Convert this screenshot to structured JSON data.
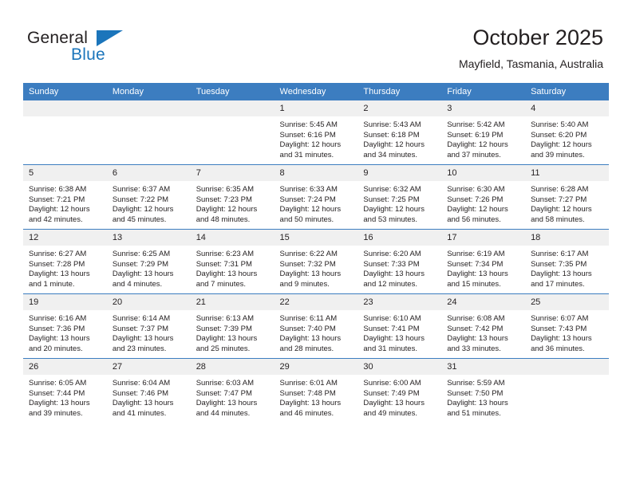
{
  "brand": {
    "name_top": "General",
    "name_bottom": "Blue",
    "triangle_icon": "triangle-icon",
    "accent_color": "#1b75bb"
  },
  "header": {
    "title": "October 2025",
    "subtitle": "Mayfield, Tasmania, Australia"
  },
  "calendar": {
    "header_bg": "#3c7dc0",
    "daynum_bg": "#f0f0f0",
    "weekdays": [
      "Sunday",
      "Monday",
      "Tuesday",
      "Wednesday",
      "Thursday",
      "Friday",
      "Saturday"
    ],
    "weeks": [
      [
        {
          "day": "",
          "empty": true
        },
        {
          "day": "",
          "empty": true
        },
        {
          "day": "",
          "empty": true
        },
        {
          "day": "1",
          "sunrise": "Sunrise: 5:45 AM",
          "sunset": "Sunset: 6:16 PM",
          "daylight1": "Daylight: 12 hours",
          "daylight2": "and 31 minutes."
        },
        {
          "day": "2",
          "sunrise": "Sunrise: 5:43 AM",
          "sunset": "Sunset: 6:18 PM",
          "daylight1": "Daylight: 12 hours",
          "daylight2": "and 34 minutes."
        },
        {
          "day": "3",
          "sunrise": "Sunrise: 5:42 AM",
          "sunset": "Sunset: 6:19 PM",
          "daylight1": "Daylight: 12 hours",
          "daylight2": "and 37 minutes."
        },
        {
          "day": "4",
          "sunrise": "Sunrise: 5:40 AM",
          "sunset": "Sunset: 6:20 PM",
          "daylight1": "Daylight: 12 hours",
          "daylight2": "and 39 minutes."
        }
      ],
      [
        {
          "day": "5",
          "sunrise": "Sunrise: 6:38 AM",
          "sunset": "Sunset: 7:21 PM",
          "daylight1": "Daylight: 12 hours",
          "daylight2": "and 42 minutes."
        },
        {
          "day": "6",
          "sunrise": "Sunrise: 6:37 AM",
          "sunset": "Sunset: 7:22 PM",
          "daylight1": "Daylight: 12 hours",
          "daylight2": "and 45 minutes."
        },
        {
          "day": "7",
          "sunrise": "Sunrise: 6:35 AM",
          "sunset": "Sunset: 7:23 PM",
          "daylight1": "Daylight: 12 hours",
          "daylight2": "and 48 minutes."
        },
        {
          "day": "8",
          "sunrise": "Sunrise: 6:33 AM",
          "sunset": "Sunset: 7:24 PM",
          "daylight1": "Daylight: 12 hours",
          "daylight2": "and 50 minutes."
        },
        {
          "day": "9",
          "sunrise": "Sunrise: 6:32 AM",
          "sunset": "Sunset: 7:25 PM",
          "daylight1": "Daylight: 12 hours",
          "daylight2": "and 53 minutes."
        },
        {
          "day": "10",
          "sunrise": "Sunrise: 6:30 AM",
          "sunset": "Sunset: 7:26 PM",
          "daylight1": "Daylight: 12 hours",
          "daylight2": "and 56 minutes."
        },
        {
          "day": "11",
          "sunrise": "Sunrise: 6:28 AM",
          "sunset": "Sunset: 7:27 PM",
          "daylight1": "Daylight: 12 hours",
          "daylight2": "and 58 minutes."
        }
      ],
      [
        {
          "day": "12",
          "sunrise": "Sunrise: 6:27 AM",
          "sunset": "Sunset: 7:28 PM",
          "daylight1": "Daylight: 13 hours",
          "daylight2": "and 1 minute."
        },
        {
          "day": "13",
          "sunrise": "Sunrise: 6:25 AM",
          "sunset": "Sunset: 7:29 PM",
          "daylight1": "Daylight: 13 hours",
          "daylight2": "and 4 minutes."
        },
        {
          "day": "14",
          "sunrise": "Sunrise: 6:23 AM",
          "sunset": "Sunset: 7:31 PM",
          "daylight1": "Daylight: 13 hours",
          "daylight2": "and 7 minutes."
        },
        {
          "day": "15",
          "sunrise": "Sunrise: 6:22 AM",
          "sunset": "Sunset: 7:32 PM",
          "daylight1": "Daylight: 13 hours",
          "daylight2": "and 9 minutes."
        },
        {
          "day": "16",
          "sunrise": "Sunrise: 6:20 AM",
          "sunset": "Sunset: 7:33 PM",
          "daylight1": "Daylight: 13 hours",
          "daylight2": "and 12 minutes."
        },
        {
          "day": "17",
          "sunrise": "Sunrise: 6:19 AM",
          "sunset": "Sunset: 7:34 PM",
          "daylight1": "Daylight: 13 hours",
          "daylight2": "and 15 minutes."
        },
        {
          "day": "18",
          "sunrise": "Sunrise: 6:17 AM",
          "sunset": "Sunset: 7:35 PM",
          "daylight1": "Daylight: 13 hours",
          "daylight2": "and 17 minutes."
        }
      ],
      [
        {
          "day": "19",
          "sunrise": "Sunrise: 6:16 AM",
          "sunset": "Sunset: 7:36 PM",
          "daylight1": "Daylight: 13 hours",
          "daylight2": "and 20 minutes."
        },
        {
          "day": "20",
          "sunrise": "Sunrise: 6:14 AM",
          "sunset": "Sunset: 7:37 PM",
          "daylight1": "Daylight: 13 hours",
          "daylight2": "and 23 minutes."
        },
        {
          "day": "21",
          "sunrise": "Sunrise: 6:13 AM",
          "sunset": "Sunset: 7:39 PM",
          "daylight1": "Daylight: 13 hours",
          "daylight2": "and 25 minutes."
        },
        {
          "day": "22",
          "sunrise": "Sunrise: 6:11 AM",
          "sunset": "Sunset: 7:40 PM",
          "daylight1": "Daylight: 13 hours",
          "daylight2": "and 28 minutes."
        },
        {
          "day": "23",
          "sunrise": "Sunrise: 6:10 AM",
          "sunset": "Sunset: 7:41 PM",
          "daylight1": "Daylight: 13 hours",
          "daylight2": "and 31 minutes."
        },
        {
          "day": "24",
          "sunrise": "Sunrise: 6:08 AM",
          "sunset": "Sunset: 7:42 PM",
          "daylight1": "Daylight: 13 hours",
          "daylight2": "and 33 minutes."
        },
        {
          "day": "25",
          "sunrise": "Sunrise: 6:07 AM",
          "sunset": "Sunset: 7:43 PM",
          "daylight1": "Daylight: 13 hours",
          "daylight2": "and 36 minutes."
        }
      ],
      [
        {
          "day": "26",
          "sunrise": "Sunrise: 6:05 AM",
          "sunset": "Sunset: 7:44 PM",
          "daylight1": "Daylight: 13 hours",
          "daylight2": "and 39 minutes."
        },
        {
          "day": "27",
          "sunrise": "Sunrise: 6:04 AM",
          "sunset": "Sunset: 7:46 PM",
          "daylight1": "Daylight: 13 hours",
          "daylight2": "and 41 minutes."
        },
        {
          "day": "28",
          "sunrise": "Sunrise: 6:03 AM",
          "sunset": "Sunset: 7:47 PM",
          "daylight1": "Daylight: 13 hours",
          "daylight2": "and 44 minutes."
        },
        {
          "day": "29",
          "sunrise": "Sunrise: 6:01 AM",
          "sunset": "Sunset: 7:48 PM",
          "daylight1": "Daylight: 13 hours",
          "daylight2": "and 46 minutes."
        },
        {
          "day": "30",
          "sunrise": "Sunrise: 6:00 AM",
          "sunset": "Sunset: 7:49 PM",
          "daylight1": "Daylight: 13 hours",
          "daylight2": "and 49 minutes."
        },
        {
          "day": "31",
          "sunrise": "Sunrise: 5:59 AM",
          "sunset": "Sunset: 7:50 PM",
          "daylight1": "Daylight: 13 hours",
          "daylight2": "and 51 minutes."
        },
        {
          "day": "",
          "empty": true
        }
      ]
    ]
  }
}
